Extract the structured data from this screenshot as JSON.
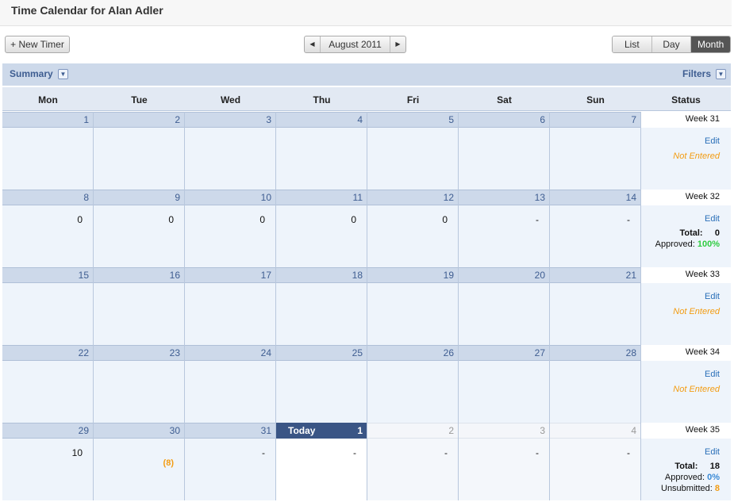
{
  "header": {
    "title": "Time Calendar for Alan Adler"
  },
  "toolbar": {
    "new_timer": "+ New Timer",
    "month_label": "August 2011",
    "views": [
      "List",
      "Day",
      "Month"
    ],
    "active_view": "Month"
  },
  "summarybar": {
    "summary": "Summary",
    "filters": "Filters"
  },
  "calendar": {
    "dow": [
      "Mon",
      "Tue",
      "Wed",
      "Thu",
      "Fri",
      "Sat",
      "Sun",
      "Status"
    ],
    "weeks": [
      {
        "week_label": "Week 31",
        "days": [
          {
            "num": "1",
            "val": ""
          },
          {
            "num": "2",
            "val": ""
          },
          {
            "num": "3",
            "val": ""
          },
          {
            "num": "4",
            "val": ""
          },
          {
            "num": "5",
            "val": ""
          },
          {
            "num": "6",
            "val": ""
          },
          {
            "num": "7",
            "val": ""
          }
        ],
        "edit": "Edit",
        "status_text": "Not Entered"
      },
      {
        "week_label": "Week 32",
        "days": [
          {
            "num": "8",
            "val": "0"
          },
          {
            "num": "9",
            "val": "0"
          },
          {
            "num": "10",
            "val": "0"
          },
          {
            "num": "11",
            "val": "0"
          },
          {
            "num": "12",
            "val": "0"
          },
          {
            "num": "13",
            "val": "-"
          },
          {
            "num": "14",
            "val": "-"
          }
        ],
        "edit": "Edit",
        "total_label": "Total:",
        "total_value": "0",
        "approved_label": "Approved:",
        "approved_value": "100%"
      },
      {
        "week_label": "Week 33",
        "days": [
          {
            "num": "15",
            "val": ""
          },
          {
            "num": "16",
            "val": ""
          },
          {
            "num": "17",
            "val": ""
          },
          {
            "num": "18",
            "val": ""
          },
          {
            "num": "19",
            "val": ""
          },
          {
            "num": "20",
            "val": ""
          },
          {
            "num": "21",
            "val": ""
          }
        ],
        "edit": "Edit",
        "status_text": "Not Entered"
      },
      {
        "week_label": "Week 34",
        "days": [
          {
            "num": "22",
            "val": ""
          },
          {
            "num": "23",
            "val": ""
          },
          {
            "num": "24",
            "val": ""
          },
          {
            "num": "25",
            "val": ""
          },
          {
            "num": "26",
            "val": ""
          },
          {
            "num": "27",
            "val": ""
          },
          {
            "num": "28",
            "val": ""
          }
        ],
        "edit": "Edit",
        "status_text": "Not Entered"
      },
      {
        "week_label": "Week 35",
        "days": [
          {
            "num": "29",
            "val": "10"
          },
          {
            "num": "30",
            "val": "",
            "val2": "(8)"
          },
          {
            "num": "31",
            "val": "-"
          },
          {
            "num": "1",
            "val": "-",
            "today_label": "Today"
          },
          {
            "num": "2",
            "val": "-"
          },
          {
            "num": "3",
            "val": "-"
          },
          {
            "num": "4",
            "val": "-"
          }
        ],
        "edit": "Edit",
        "total_label": "Total:",
        "total_value": "18",
        "approved_label": "Approved:",
        "approved_value": "0%",
        "unsubmitted_label": "Unsubmitted:",
        "unsubmitted_value": "8"
      }
    ]
  }
}
